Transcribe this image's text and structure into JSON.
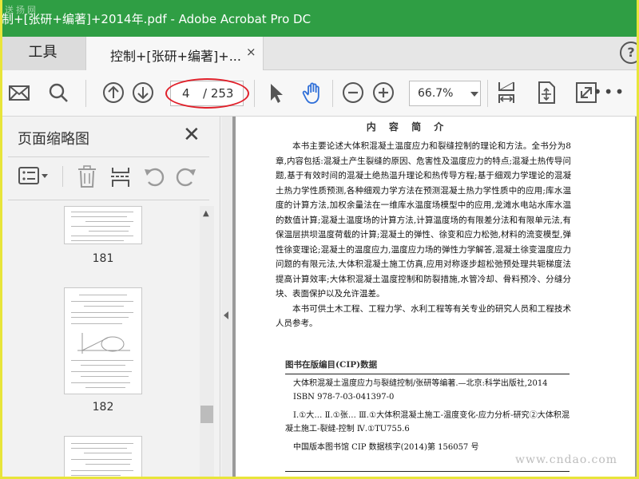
{
  "window": {
    "title": "制+[张研+编著]+2014年.pdf - Adobe Acrobat Pro DC",
    "watermark_top": "送扬网"
  },
  "tabs": {
    "tools_label": "工具",
    "doc_label": "控制+[张研+编著]+...",
    "close_glyph": "×",
    "help_glyph": "?"
  },
  "toolbar": {
    "current_page": "4",
    "total_pages": "/ 253",
    "zoom": "66.7%",
    "more_glyph": "•••"
  },
  "panel": {
    "title": "页面缩略图",
    "close_glyph": "✕",
    "thumbnails": [
      {
        "page": "181"
      },
      {
        "page": "182"
      }
    ]
  },
  "document": {
    "heading": "内 容 简 介",
    "paragraphs": [
      "本书主要论述大体积混凝土温度应力和裂缝控制的理论和方法。全书分为8章,内容包括:混凝土产生裂缝的原因、危害性及温度应力的特点;混凝土热传导问题,基于有效时间的混凝土绝热温升理论和热传导方程;基于细观力学理论的混凝土热力学性质预测,各种细观力学方法在预测混凝土热力学性质中的应用;库水温度的计算方法,加权余量法在一维库水温度场模型中的应用,龙滩水电站水库水温的数值计算;混凝土温度场的计算方法,计算温度场的有限差分法和有限单元法,有保温层拱坝温度荷载的计算;混凝土的弹性、徐变和应力松弛,材料的流变模型,弹性徐变理论;混凝土的温度应力,温度应力场的弹性力学解答,混凝土徐变温度应力问题的有限元法,大体积混凝土施工仿真,应用对称逐步超松弛预处理共轭梯度法提高计算效率;大体积混凝土温度控制和防裂措施,水管冷却、骨料预冷、分缝分块、表面保护以及允许温差。",
      "本书可供土木工程、工程力学、水利工程等有关专业的研究人员和工程技术人员参考。"
    ],
    "cip_heading": "图书在版编目(CIP)数据",
    "cip_lines": [
      "大体积混凝土温度应力与裂缝控制/张研等编著.—北京:科学出版社,2014",
      "ISBN 978-7-03-041397-0",
      "Ⅰ.①大…  Ⅱ.①张…  Ⅲ.①大体积混凝土施工-温度变化-应力分析-研究②大体积混凝土施工-裂缝-控制  Ⅳ.①TU755.6",
      "中国版本图书馆 CIP 数据核字(2014)第 156057 号"
    ],
    "watermark": "www.cndao.com"
  },
  "colors": {
    "titlebar": "#2f9e44",
    "highlight_oval": "#e0202a",
    "frame": "#e8e53a",
    "hand_tool": "#2f6fd8"
  }
}
